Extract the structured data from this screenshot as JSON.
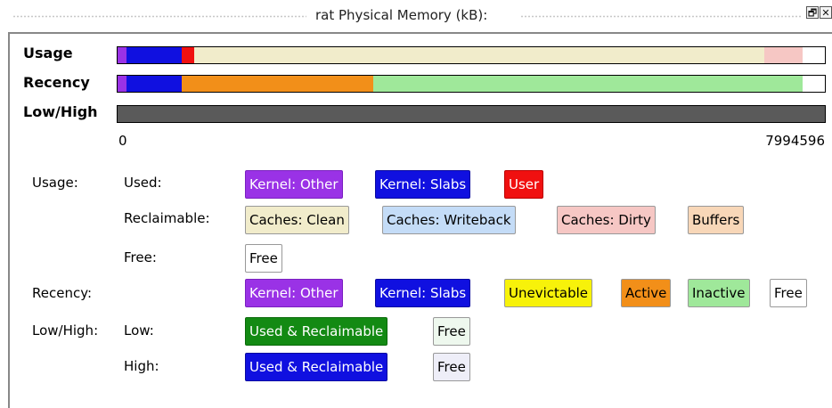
{
  "window": {
    "title": "rat Physical Memory (kB):",
    "restore_glyph": "🗗",
    "close_glyph": "✕"
  },
  "bars": {
    "usage_label": "Usage",
    "recency_label": "Recency",
    "lowhigh_label": "Low/High",
    "axis_min": "0",
    "axis_max": "7994596",
    "usage_segments": [
      {
        "name": "Kernel: Other",
        "fraction": 0.013,
        "color": "#9a32e6"
      },
      {
        "name": "Kernel: Slabs",
        "fraction": 0.078,
        "color": "#1010e0"
      },
      {
        "name": "User",
        "fraction": 0.017,
        "color": "#f01010"
      },
      {
        "name": "Caches: Clean",
        "fraction": 0.806,
        "color": "#f1eccb"
      },
      {
        "name": "Caches: Dirty",
        "fraction": 0.054,
        "color": "#f6c7c4"
      },
      {
        "name": "Free",
        "fraction": 0.032,
        "color": "#ffffff"
      }
    ],
    "recency_segments": [
      {
        "name": "Kernel: Other",
        "fraction": 0.013,
        "color": "#9a32e6"
      },
      {
        "name": "Kernel: Slabs",
        "fraction": 0.078,
        "color": "#1010e0"
      },
      {
        "name": "Active",
        "fraction": 0.27,
        "color": "#f28f19"
      },
      {
        "name": "Inactive",
        "fraction": 0.607,
        "color": "#9fe89a"
      },
      {
        "name": "Free",
        "fraction": 0.032,
        "color": "#ffffff"
      }
    ],
    "lowhigh_segments": [
      {
        "name": "Low/High",
        "fraction": 1.0,
        "color": "#5a5a5a"
      }
    ]
  },
  "legend": {
    "usage_label": "Usage:",
    "used_label": "Used:",
    "reclaimable_label": "Reclaimable:",
    "free_label": "Free:",
    "recency_label": "Recency:",
    "lowhigh_label": "Low/High:",
    "low_label": "Low:",
    "high_label": "High:",
    "used_chips": [
      "Kernel: Other",
      "Kernel: Slabs",
      "User"
    ],
    "reclaimable_chips": [
      "Caches: Clean",
      "Caches: Writeback",
      "Caches: Dirty",
      "Buffers"
    ],
    "free_chips": [
      "Free"
    ],
    "recency_chips": [
      "Kernel: Other",
      "Kernel: Slabs",
      "Unevictable",
      "Active",
      "Inactive",
      "Free"
    ],
    "low_chips": [
      "Used & Reclaimable",
      "Free"
    ],
    "high_chips": [
      "Used & Reclaimable",
      "Free"
    ]
  },
  "colors": {
    "kernel_other": "#9a32e6",
    "kernel_slabs": "#1010e0",
    "user": "#f01010",
    "caches_clean": "#f1eccb",
    "caches_writeback": "#c4dcf7",
    "caches_dirty": "#f6c7c4",
    "buffers": "#f8d7b8",
    "unevictable": "#f7f20a",
    "active": "#f28f19",
    "inactive": "#9fe89a",
    "low_used": "#138a13",
    "low_free": "#eef8ee",
    "high_used": "#1010e0",
    "high_free": "#eeeef8"
  }
}
